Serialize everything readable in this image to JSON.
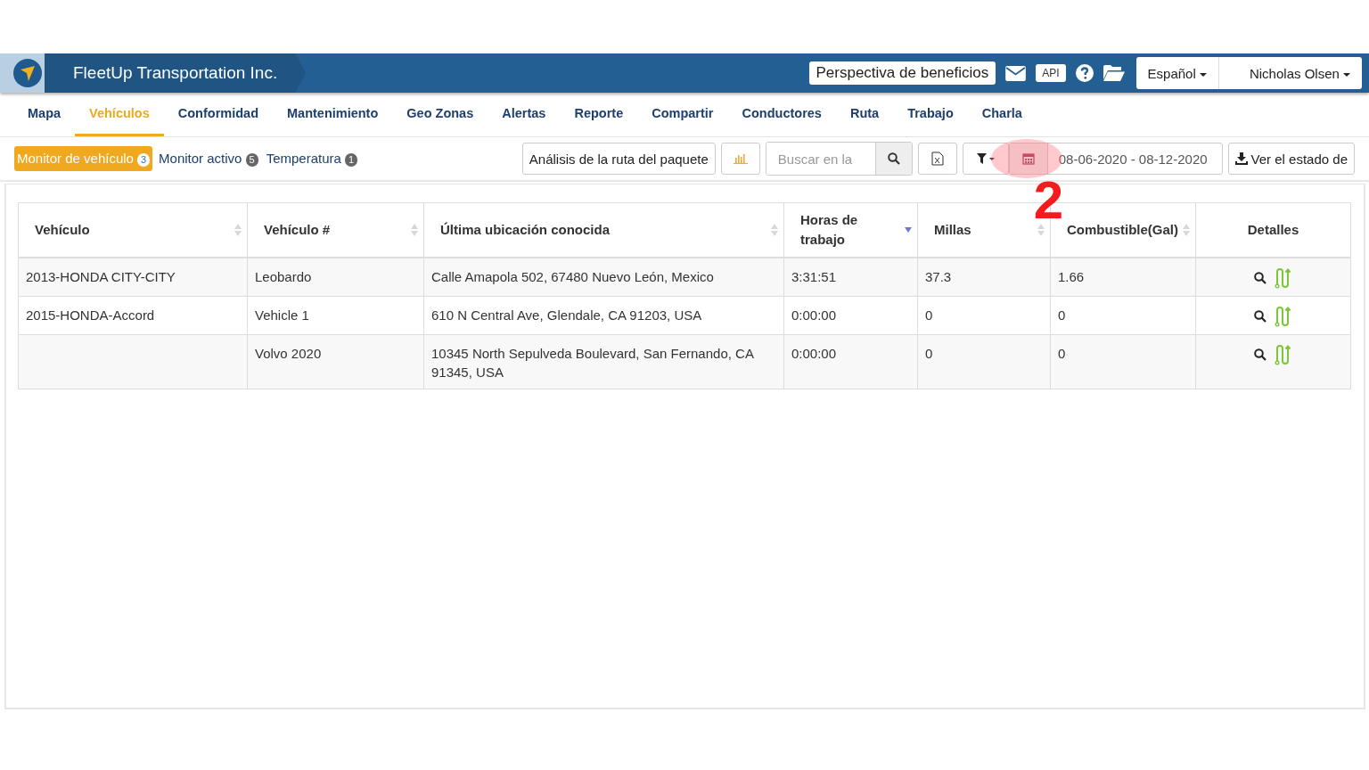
{
  "header": {
    "company": "FleetUp Transportation Inc.",
    "benefits_button": "Perspectiva de beneficios",
    "api_button": "API",
    "language": "Español",
    "user": "Nicholas Olsen"
  },
  "tabs": [
    {
      "label": "Mapa",
      "selected": false
    },
    {
      "label": "Vehículos",
      "selected": true
    },
    {
      "label": "Conformidad",
      "selected": false
    },
    {
      "label": "Mantenimiento",
      "selected": false
    },
    {
      "label": "Geo Zonas",
      "selected": false
    },
    {
      "label": "Alertas",
      "selected": false
    },
    {
      "label": "Reporte",
      "selected": false
    },
    {
      "label": "Compartir",
      "selected": false
    },
    {
      "label": "Conductores",
      "selected": false
    },
    {
      "label": "Ruta",
      "selected": false
    },
    {
      "label": "Trabajo",
      "selected": false
    },
    {
      "label": "Charla",
      "selected": false
    }
  ],
  "subtabs": [
    {
      "label": "Monitor de vehículo",
      "count": "3",
      "selected": true
    },
    {
      "label": "Monitor activo",
      "count": "5",
      "selected": false
    },
    {
      "label": "Temperatura",
      "count": "1",
      "selected": false
    }
  ],
  "toolbar": {
    "route_analysis_button": "Análisis de la ruta del paquete",
    "search": {
      "placeholder": "Buscar en la"
    },
    "date_range": "08-06-2020 - 08-12-2020",
    "status_button": "Ver el estado de"
  },
  "annotation": {
    "step": "2"
  },
  "table": {
    "columns": [
      {
        "label": "Vehículo",
        "sortable": true,
        "sorted": false
      },
      {
        "label": "Vehículo #",
        "sortable": true,
        "sorted": false
      },
      {
        "label": "Última ubicación conocida",
        "sortable": true,
        "sorted": false
      },
      {
        "label": "Horas de trabajo",
        "sortable": true,
        "sorted": true
      },
      {
        "label": "Millas",
        "sortable": true,
        "sorted": false
      },
      {
        "label": "Combustible(Gal)",
        "sortable": true,
        "sorted": false
      },
      {
        "label": "Detalles",
        "sortable": false,
        "sorted": false
      }
    ],
    "rows": [
      [
        "2013-HONDA CITY-CITY",
        "Leobardo",
        "Calle Amapola 502, 67480 Nuevo León, Mexico",
        "3:31:51",
        "37.3",
        "1.66"
      ],
      [
        "2015-HONDA-Accord",
        "Vehicle 1",
        "610 N Central Ave, Glendale, CA 91203, USA",
        "0:00:00",
        "0",
        "0"
      ],
      [
        "",
        "Volvo 2020",
        "10345 North Sepulveda Boulevard, San Fernando, CA 91345, USA",
        "0:00:00",
        "0",
        "0"
      ]
    ]
  }
}
